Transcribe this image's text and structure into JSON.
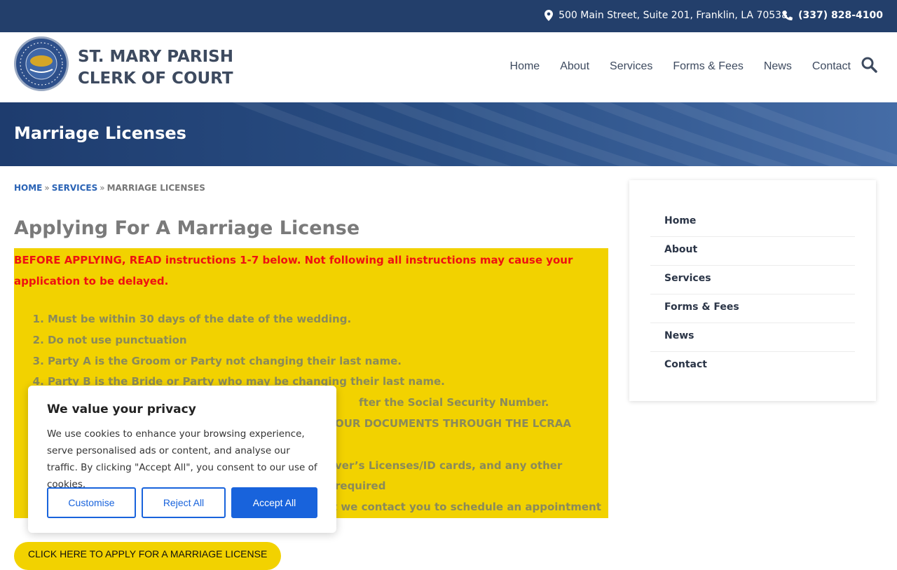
{
  "topbar": {
    "address": "500 Main Street, Suite 201, Franklin, LA 70538",
    "phone": "(337) 828-4100"
  },
  "header": {
    "title_line1": "ST. MARY PARISH",
    "title_line2": "CLERK OF COURT",
    "nav": [
      "Home",
      "About",
      "Services",
      "Forms & Fees",
      "News",
      "Contact"
    ]
  },
  "hero": {
    "title": "Marriage Licenses"
  },
  "breadcrumb": {
    "home": "HOME",
    "services": "SERVICES",
    "current": "MARRIAGE LICENSES",
    "sep": "»"
  },
  "main": {
    "title": "Applying For A Marriage License",
    "warning": "BEFORE APPLYING, READ instructions 1-7 below. Not following all instructions may cause your application to be delayed.",
    "instructions": [
      "Must be within 30 days of the date of the wedding.",
      "Do not use punctuation",
      "Party A is the Groom or Party not changing their last name.",
      "Party B is the Bride or Party who may be changing their last name.",
      "fter the Social Security Number.",
      "OUR DOCUMENTS THROUGH THE LCRAA",
      "ver’s Licenses/ID cards, and any other required",
      "st we contact you to schedule an appointment"
    ],
    "apply_button": "CLICK HERE TO APPLY FOR A MARRIAGE LICENSE"
  },
  "sidebar": {
    "items": [
      "Home",
      "About",
      "Services",
      "Forms & Fees",
      "News",
      "Contact"
    ]
  },
  "cookie": {
    "title": "We value your privacy",
    "body": "We use cookies to enhance your browsing experience, serve personalised ads or content, and analyse our traffic. By clicking \"Accept All\", you consent to our use of cookies.",
    "customise": "Customise",
    "reject": "Reject All",
    "accept": "Accept All"
  },
  "colors": {
    "topbar": "#233f6b",
    "accent_yellow": "#f2d200",
    "warning_red": "#ee1111",
    "link_blue": "#2a63b5",
    "cookie_blue": "#1863dc"
  }
}
